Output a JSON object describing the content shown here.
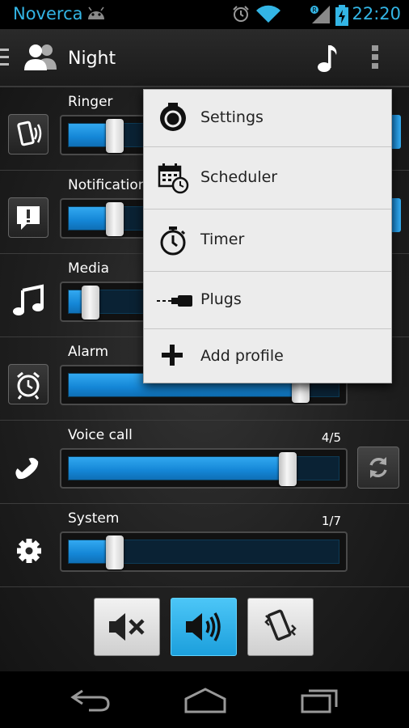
{
  "status_bar": {
    "carrier": "Noverca",
    "time": "22:20",
    "icons": [
      "android-icon",
      "alarm-clock-icon",
      "wifi-icon",
      "signal-roaming-icon",
      "battery-charging-icon"
    ]
  },
  "action_bar": {
    "title": "Night",
    "icons": [
      "menu-handle-icon",
      "profile-users-icon",
      "music-note-icon",
      "overflow-menu-icon"
    ]
  },
  "volume_rows": [
    {
      "label": "Ringer",
      "count": "",
      "level": 0.17,
      "icon": "ringer-vibrate-icon"
    },
    {
      "label": "Notification",
      "count": "",
      "level": 0.17,
      "icon": "notification-alert-icon"
    },
    {
      "label": "Media",
      "count": "",
      "level": 0.08,
      "icon": "music-note-icon"
    },
    {
      "label": "Alarm",
      "count": "",
      "level": 0.86,
      "icon": "alarm-clock-icon"
    },
    {
      "label": "Voice call",
      "count": "4/5",
      "level": 0.81,
      "icon": "phone-icon"
    },
    {
      "label": "System",
      "count": "1/7",
      "level": 0.17,
      "icon": "gear-icon"
    }
  ],
  "sync_button": {
    "icon": "sync-icon"
  },
  "mode_buttons": [
    {
      "name": "mute",
      "icon": "mute-speaker-icon",
      "active": false
    },
    {
      "name": "sound",
      "icon": "speaker-on-icon",
      "active": true
    },
    {
      "name": "vibrate",
      "icon": "vibrate-phone-icon",
      "active": false
    }
  ],
  "menu": {
    "items": [
      {
        "label": "Settings",
        "icon": "settings-icon"
      },
      {
        "label": "Scheduler",
        "icon": "calendar-clock-icon"
      },
      {
        "label": "Timer",
        "icon": "stopwatch-icon"
      },
      {
        "label": "Plugs",
        "icon": "plug-icon"
      },
      {
        "label": "Add profile",
        "icon": "plus-icon"
      }
    ]
  },
  "nav_bar": {
    "icons": [
      "back-icon",
      "home-icon",
      "recent-apps-icon"
    ]
  },
  "colors": {
    "accent": "#33b5e5",
    "fill": "#1486d6",
    "menu_bg": "#ececec"
  }
}
